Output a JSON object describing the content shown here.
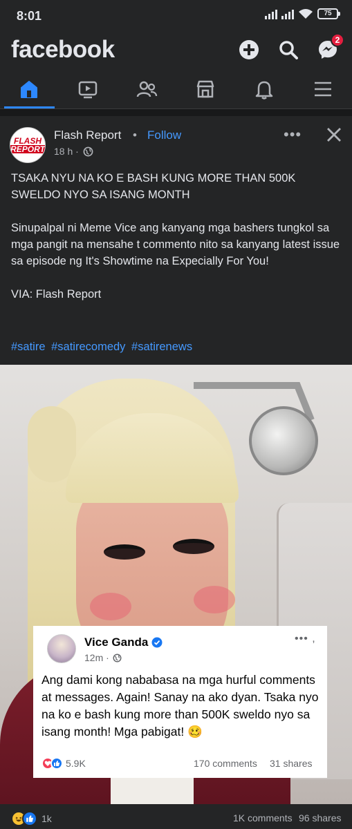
{
  "status": {
    "time": "8:01",
    "battery": "75"
  },
  "header": {
    "logo": "facebook",
    "messenger_badge": "2"
  },
  "tabs": [
    {
      "icon": "home-icon",
      "active": true
    },
    {
      "icon": "video-icon",
      "active": false
    },
    {
      "icon": "friends-icon",
      "active": false
    },
    {
      "icon": "marketplace-icon",
      "active": false
    },
    {
      "icon": "bell-icon",
      "active": false
    },
    {
      "icon": "menu-icon",
      "active": false
    }
  ],
  "post": {
    "avatar": {
      "line1": "FLASH",
      "line2": "REPORT"
    },
    "page_name": "Flash Report",
    "separator": "•",
    "follow_label": "Follow",
    "time": "18 h ·",
    "text": {
      "headline": "TSAKA NYU NA KO E BASH KUNG MORE THAN 500K SWELDO NYO SA ISANG MONTH",
      "body": "Sinupalpal ni Meme Vice ang kanyang mga bashers tungkol sa mga pangit na mensahe t commento nito sa kanyang latest issue sa episode ng It's Showtime na Expecially For You!",
      "via": "VIA: Flash Report"
    },
    "hashtags": [
      "#satire",
      "#satirecomedy",
      "#satirenews"
    ],
    "embedded": {
      "name": "Vice Ganda",
      "time": "12m ·",
      "text": "Ang dami kong nababasa na mga hurful comments at messages. Again! Sanay na ako dyan. Tsaka nyo na ko e bash kung more than 500K sweldo nyo sa isang month! Mga pabigat! 🥴",
      "reaction_count": "5.9K",
      "comments": "170 comments",
      "shares": "31 shares"
    },
    "footer": {
      "reaction_count": "1k",
      "comments": "1K comments",
      "shares": "96 shares"
    }
  },
  "colors": {
    "accent": "#2d88ff",
    "link": "#4599ff",
    "background": "#18191a",
    "surface": "#242526"
  }
}
